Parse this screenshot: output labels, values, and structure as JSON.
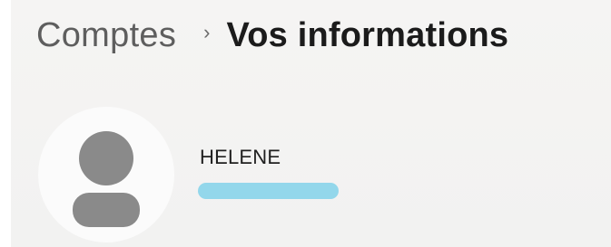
{
  "breadcrumb": {
    "parent": "Comptes",
    "separator": "›",
    "current": "Vos informations"
  },
  "user": {
    "name": "HELENE",
    "avatar_icon": "person-icon",
    "redaction_color": "#93d7eb"
  }
}
